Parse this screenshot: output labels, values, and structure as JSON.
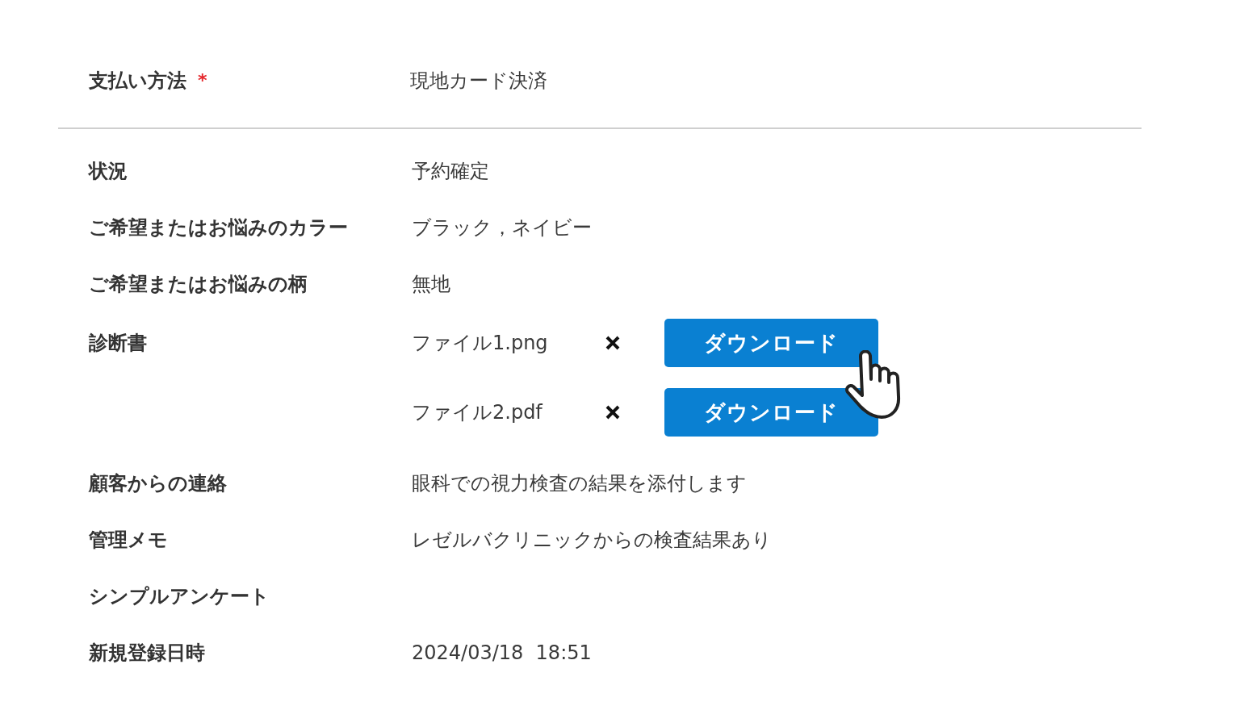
{
  "payment": {
    "label": "支払い方法",
    "required_mark": "*",
    "value": "現地カード決済"
  },
  "fields": [
    {
      "kind": "text",
      "label": "状況",
      "value": "予約確定"
    },
    {
      "kind": "text",
      "label": "ご希望またはお悩みのカラー",
      "value": "ブラック，ネイビー"
    },
    {
      "kind": "text",
      "label": "ご希望またはお悩みの柄",
      "value": "無地"
    },
    {
      "kind": "files",
      "label": "診断書",
      "files": [
        {
          "name": "ファイル1.png",
          "button": "ダウンロード",
          "hovered": true
        },
        {
          "name": "ファイル2.pdf",
          "button": "ダウンロード",
          "hovered": false
        }
      ]
    },
    {
      "kind": "text",
      "label": "顧客からの連絡",
      "value": "眼科での視力検査の結果を添付します"
    },
    {
      "kind": "text",
      "label": "管理メモ",
      "value": "レゼルバクリニックからの検査結果あり"
    },
    {
      "kind": "text",
      "label": "シンプルアンケート"
    },
    {
      "kind": "text",
      "label": "新規登録日時",
      "value": "2024/03/18  18:51"
    }
  ]
}
